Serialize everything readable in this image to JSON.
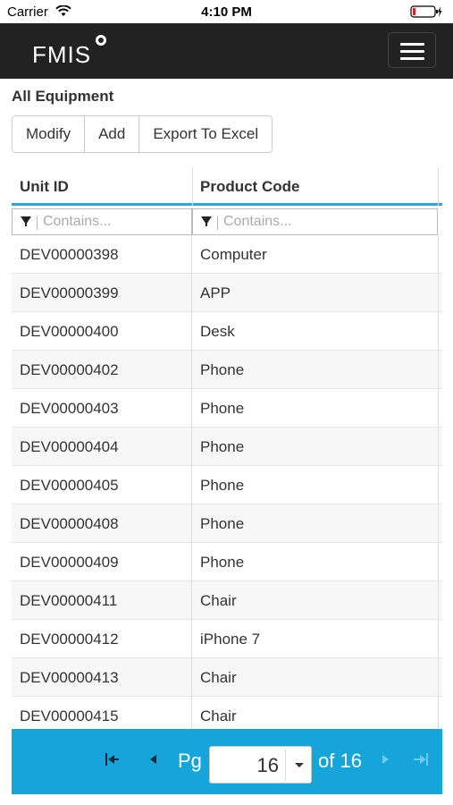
{
  "status_bar": {
    "carrier": "Carrier",
    "time": "4:10 PM"
  },
  "header": {
    "logo": "FMIS",
    "menu_icon": "hamburger-menu-icon"
  },
  "page": {
    "title": "All Equipment"
  },
  "toolbar": {
    "modify_label": "Modify",
    "add_label": "Add",
    "export_label": "Export To Excel"
  },
  "grid": {
    "columns": [
      "Unit ID",
      "Product Code"
    ],
    "filter_placeholder": "Contains...",
    "rows": [
      [
        "DEV00000398",
        "Computer"
      ],
      [
        "DEV00000399",
        "APP"
      ],
      [
        "DEV00000400",
        "Desk"
      ],
      [
        "DEV00000402",
        "Phone"
      ],
      [
        "DEV00000403",
        "Phone"
      ],
      [
        "DEV00000404",
        "Phone"
      ],
      [
        "DEV00000405",
        "Phone"
      ],
      [
        "DEV00000408",
        "Phone"
      ],
      [
        "DEV00000409",
        "Phone"
      ],
      [
        "DEV00000411",
        "Chair"
      ],
      [
        "DEV00000412",
        "iPhone 7"
      ],
      [
        "DEV00000413",
        "Chair"
      ],
      [
        "DEV00000415",
        "Chair"
      ]
    ]
  },
  "pager": {
    "pg_label": "Pg",
    "current_page": "16",
    "of_label": "of 16"
  },
  "colors": {
    "header_bg": "#222222",
    "accent": "#15a5db"
  }
}
